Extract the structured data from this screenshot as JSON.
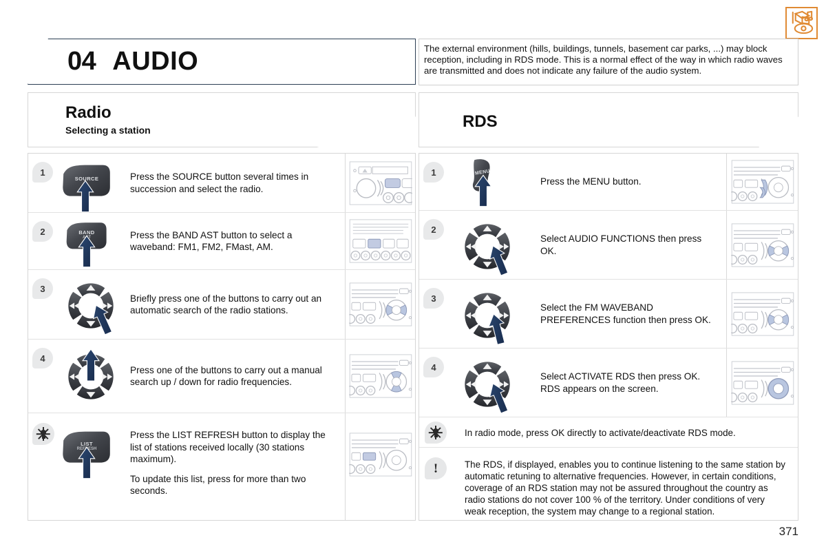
{
  "header": {
    "chapter_number": "04",
    "chapter_title": "AUDIO",
    "icon_name": "audio-media-icon",
    "accent_color": "#E08A33",
    "border_color": "#2b3d52"
  },
  "top_note": {
    "text": "The external environment (hills, buildings, tunnels, basement car parks, ...) may block reception, including in RDS mode. This is a normal effect of the way in which radio waves are transmitted and does not indicate any failure of the audio system."
  },
  "left_section": {
    "title": "Radio",
    "subtitle": "Selecting a station",
    "steps": [
      {
        "number": "1",
        "control": "stalk",
        "control_label_top": "SOURCE",
        "control_label_bottom": "",
        "arrow": "up",
        "text": "Press the SOURCE button several times in succession and select the radio.",
        "device": "head-unit-source"
      },
      {
        "number": "2",
        "control": "stalk",
        "control_label_top": "BAND",
        "control_label_bottom": "AST",
        "arrow": "up",
        "text": "Press the BAND AST button to select a waveband: FM1, FM2, FMast, AM.",
        "device": "head-unit-band"
      },
      {
        "number": "3",
        "control": "navpad",
        "arrow": "right",
        "text": "Briefly press one of the buttons to carry out an automatic search of the radio stations.",
        "device": "head-unit-navpad-lr"
      },
      {
        "number": "4",
        "control": "navpad",
        "arrow": "up",
        "text": "Press one of the buttons to carry out a manual search up / down for radio frequencies.",
        "device": "head-unit-navpad-ud"
      }
    ],
    "tip": {
      "icon": "tip-bulb-icon",
      "control": "stalk",
      "control_label_top": "LIST",
      "control_label_bottom": "REFRESH",
      "arrow": "up",
      "text_1": "Press the LIST REFRESH button to display the list of stations received locally (30 stations maximum).",
      "text_2": "To update this list, press for more than two seconds.",
      "device": "head-unit-list"
    }
  },
  "right_section": {
    "title": "RDS",
    "steps": [
      {
        "number": "1",
        "control": "stalk",
        "control_label_top": "MENU",
        "control_label_bottom": "",
        "arrow": "up",
        "text": "Press the MENU button.",
        "device": "head-unit-menu"
      },
      {
        "number": "2",
        "control": "navpad",
        "arrow": "right",
        "text": "Select AUDIO FUNCTIONS then press OK.",
        "device": "head-unit-navpad-lr"
      },
      {
        "number": "3",
        "control": "navpad",
        "arrow": "right",
        "text": "Select the FM WAVEBAND PREFERENCES function then press OK.",
        "device": "head-unit-navpad-lr"
      },
      {
        "number": "4",
        "control": "navpad",
        "arrow": "right",
        "text": "Select ACTIVATE RDS then press OK. RDS appears on the screen.",
        "device": "head-unit-navpad-ok"
      }
    ],
    "tip": {
      "icon": "tip-bulb-icon",
      "text": "In radio mode, press OK directly to activate/deactivate RDS mode."
    },
    "warning": {
      "icon": "warning-exclamation-icon",
      "text": "The RDS, if displayed, enables you to continue listening to the same station by automatic retuning to alternative frequencies. However, in certain conditions, coverage of an RDS station may not be assured throughout the country as radio stations do not cover 100 % of the territory. Under conditions of very weak reception, the system may change to a regional station."
    }
  },
  "footer": {
    "page_number": "371"
  }
}
